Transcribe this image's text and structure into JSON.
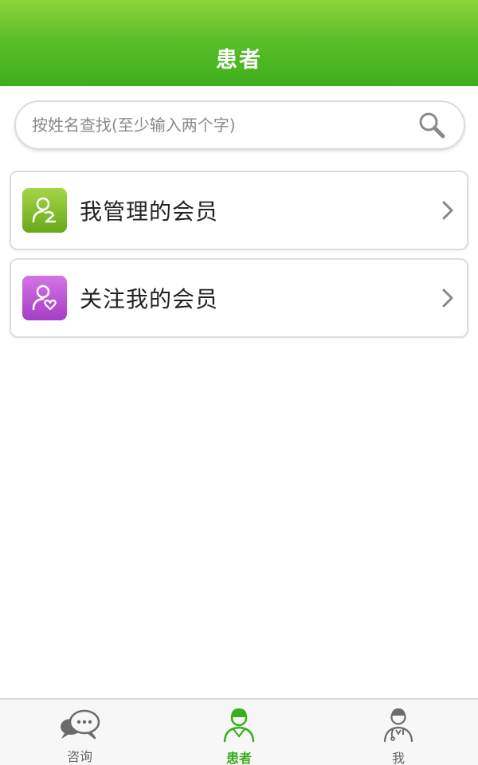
{
  "header": {
    "title": "患者"
  },
  "search": {
    "placeholder": "按姓名查找(至少输入两个字)",
    "value": ""
  },
  "list": {
    "items": [
      {
        "label": "我管理的会员",
        "icon": "managed-member-icon",
        "color": "#7bb62a"
      },
      {
        "label": "关注我的会员",
        "icon": "follower-member-icon",
        "color": "#b84fd3"
      }
    ]
  },
  "tabbar": {
    "tabs": [
      {
        "label": "咨询",
        "icon": "chat-bubble-icon",
        "active": false
      },
      {
        "label": "患者",
        "icon": "patient-icon",
        "active": true
      },
      {
        "label": "我",
        "icon": "doctor-icon",
        "active": false
      }
    ],
    "active_color": "#3aae1c"
  },
  "colors": {
    "brand": "#5cbf2a"
  }
}
